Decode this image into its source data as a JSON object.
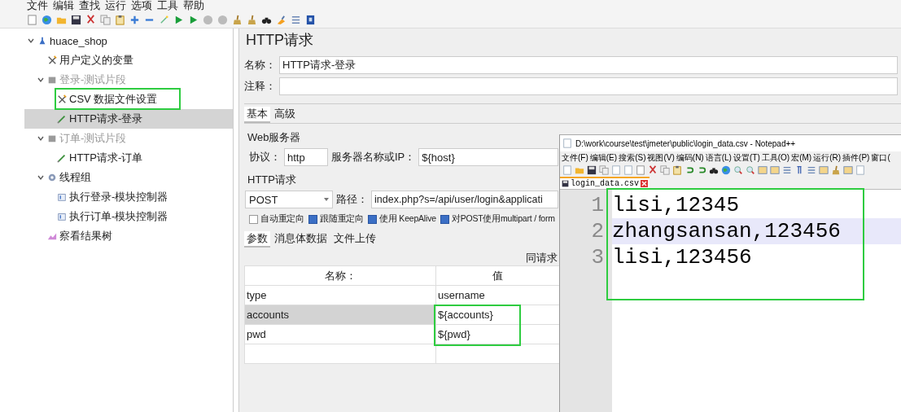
{
  "menu": [
    "文件",
    "编辑",
    "查找",
    "运行",
    "选项",
    "工具",
    "帮助"
  ],
  "tree": [
    {
      "label": "huace_shop",
      "kind": "plan",
      "expanded": true,
      "disabled": false,
      "selected": false,
      "children": [
        {
          "label": "用户定义的变量",
          "kind": "config",
          "disabled": false,
          "selected": false
        },
        {
          "label": "登录-测试片段",
          "kind": "fragment",
          "expanded": true,
          "disabled": true,
          "selected": false,
          "children": [
            {
              "label": "CSV 数据文件设置",
              "kind": "config",
              "disabled": false,
              "selected": false
            },
            {
              "label": "HTTP请求-登录",
              "kind": "sampler",
              "disabled": false,
              "selected": true
            }
          ]
        },
        {
          "label": "订单-测试片段",
          "kind": "fragment",
          "expanded": true,
          "disabled": true,
          "selected": false,
          "children": [
            {
              "label": "HTTP请求-订单",
              "kind": "sampler",
              "disabled": false,
              "selected": false
            }
          ]
        },
        {
          "label": "线程组",
          "kind": "threads",
          "expanded": true,
          "disabled": false,
          "selected": false,
          "children": [
            {
              "label": "执行登录-模块控制器",
              "kind": "controller",
              "disabled": false,
              "selected": false
            },
            {
              "label": "执行订单-模块控制器",
              "kind": "controller",
              "disabled": false,
              "selected": false
            }
          ]
        },
        {
          "label": "察看结果树",
          "kind": "listener",
          "disabled": false,
          "selected": false
        }
      ]
    }
  ],
  "editor": {
    "title": "HTTP请求",
    "name_label": "名称：",
    "name_value": "HTTP请求-登录",
    "comment_label": "注释：",
    "tabs": [
      {
        "label": "基本",
        "selected": true
      },
      {
        "label": "高级",
        "selected": false
      }
    ],
    "web_server": {
      "legend": "Web服务器",
      "protocol_label": "协议：",
      "protocol": "http",
      "server_label": "服务器名称或IP：",
      "server": "${host}"
    },
    "http_request": {
      "legend": "HTTP请求",
      "method": "POST",
      "path_label": "路径：",
      "path": "index.php?s=/api/user/login&applicati"
    },
    "options": [
      {
        "label": "自动重定向",
        "checked": false
      },
      {
        "label": "跟随重定向",
        "checked": true
      },
      {
        "label": "使用 KeepAlive",
        "checked": true
      },
      {
        "label": "对POST使用multipart / form",
        "checked": true
      }
    ],
    "sub_tabs": [
      {
        "label": "参数",
        "selected": true
      },
      {
        "label": "消息体数据",
        "selected": false
      },
      {
        "label": "文件上传",
        "selected": false
      }
    ],
    "table_caption": "同请求",
    "columns": [
      "名称：",
      "值"
    ],
    "rows": [
      {
        "name": "type",
        "value": "username",
        "selected": false
      },
      {
        "name": "accounts",
        "value": "${accounts}",
        "selected": true
      },
      {
        "name": "pwd",
        "value": "${pwd}",
        "selected": false
      }
    ]
  },
  "notepad": {
    "title": "D:\\work\\course\\test\\jmeter\\public\\login_data.csv - Notepad++",
    "menu": [
      "文件(F)",
      "编辑(E)",
      "搜索(S)",
      "视图(V)",
      "编码(N)",
      "语言(L)",
      "设置(T)",
      "工具(O)",
      "宏(M)",
      "运行(R)",
      "插件(P)",
      "窗口("
    ],
    "tab": "login_data.csv",
    "lines": [
      {
        "number": "1",
        "text": "lisi,12345",
        "current": false
      },
      {
        "number": "2",
        "text": "zhangsansan,123456",
        "current": true
      },
      {
        "number": "3",
        "text": "lisi,123456",
        "current": false
      }
    ]
  }
}
